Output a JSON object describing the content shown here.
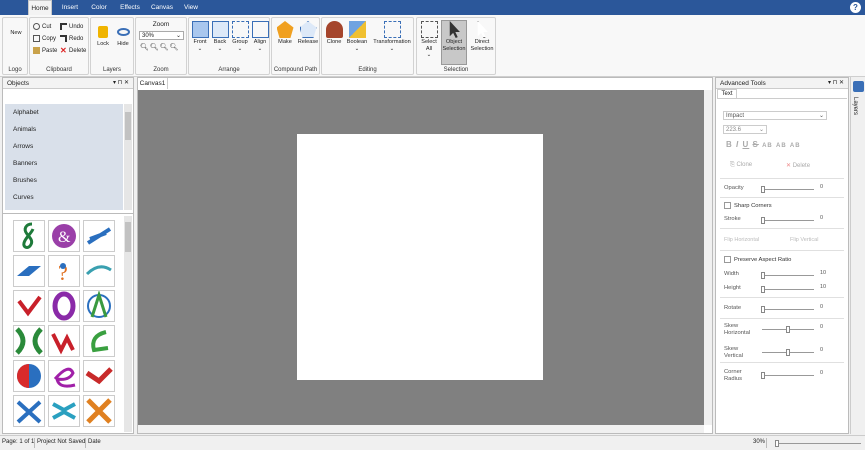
{
  "menu": {
    "tabs": [
      "Home",
      "Insert",
      "Color",
      "Effects",
      "Canvas",
      "View"
    ]
  },
  "ribbon": {
    "new": "New",
    "logo_group": "Logo",
    "cut": "Cut",
    "copy": "Copy",
    "paste": "Paste",
    "undo": "Undo",
    "redo": "Redo",
    "delete": "Delete",
    "clipboard_group": "Clipboard",
    "lock": "Lock",
    "hide": "Hide",
    "layers_group": "Layers",
    "zoom_title": "Zoom",
    "zoom_value": "30%",
    "zoom_group": "Zoom",
    "front": "Front",
    "back": "Back",
    "group": "Group",
    "align": "Align",
    "arrange_group": "Arrange",
    "make": "Make",
    "release": "Release",
    "compound_group": "Compound Path",
    "clone": "Clone",
    "boolean": "Boolean",
    "transformation": "Transformation",
    "editing_group": "Editing",
    "select_all_1": "Select",
    "select_all_2": "All",
    "obj_sel_1": "Object",
    "obj_sel_2": "Selection",
    "dir_sel_1": "Direct",
    "dir_sel_2": "Selection",
    "selection_group": "Selection"
  },
  "objects_panel": {
    "title": "Objects",
    "items": [
      "Alphabet",
      "Animals",
      "Arrows",
      "Banners",
      "Brushes",
      "Curves"
    ]
  },
  "canvas": {
    "tab": "Canvas1"
  },
  "advanced": {
    "title": "Advanced Tools",
    "tab": "Text",
    "font": "Impact",
    "size": "223.6",
    "styles": [
      "B",
      "I",
      "U",
      "S",
      "AB",
      "AB",
      "AB"
    ],
    "clone": "Clone",
    "delete": "Delete",
    "opacity": "Opacity",
    "opacity_val": "0",
    "sharp": "Sharp Corners",
    "stroke": "Stroke",
    "stroke_val": "0",
    "flip_h": "Flip Horizontal",
    "flip_v": "Flip Vertical",
    "preserve": "Preserve Aspect Ratio",
    "width": "Width",
    "width_val": "10",
    "height": "Height",
    "height_val": "10",
    "rotate": "Rotate",
    "rotate_val": "0",
    "skew_h_1": "Skew",
    "skew_h_2": "Horizontal",
    "skew_h_val": "0",
    "skew_v_1": "Skew",
    "skew_v_2": "Vertical",
    "skew_v_val": "0",
    "corner_1": "Corner",
    "corner_2": "Radius",
    "corner_val": "0",
    "layers_tab": "Layers"
  },
  "status": {
    "page": "Page: 1 of 1",
    "saved": "Project Not Saved",
    "date": "Date",
    "zoom": "30%"
  }
}
